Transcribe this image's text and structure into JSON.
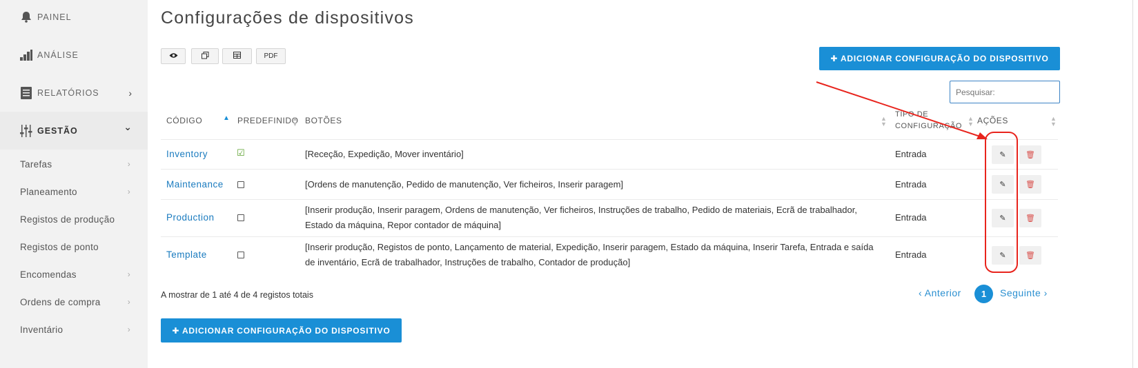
{
  "sidebar": {
    "main_items": [
      {
        "label": "PAINEL",
        "icon": "bell-icon"
      },
      {
        "label": "ANÁLISE",
        "icon": "bar-chart-icon"
      },
      {
        "label": "RELATÓRIOS",
        "icon": "reports-icon",
        "chevron": "›"
      },
      {
        "label": "GESTÃO",
        "icon": "sliders-icon",
        "chevron": "⌄"
      }
    ],
    "sub_items": [
      {
        "label": "Tarefas",
        "chevron": "›"
      },
      {
        "label": "Planeamento",
        "chevron": "›"
      },
      {
        "label": "Registos de produção",
        "chevron": ""
      },
      {
        "label": "Registos de ponto",
        "chevron": ""
      },
      {
        "label": "Encomendas",
        "chevron": "›"
      },
      {
        "label": "Ordens de compra",
        "chevron": "›"
      },
      {
        "label": "Inventário",
        "chevron": "›"
      }
    ]
  },
  "page": {
    "title": "Configurações de dispositivos",
    "toolbar": {
      "view_icon": "eye-icon",
      "copy_icon": "copy-icon",
      "table_icon": "table-icon",
      "pdf_label": "PDF"
    },
    "add_button_label": "✚ ADICIONAR CONFIGURAÇÃO DO DISPOSITIVO",
    "search_placeholder": "Pesquisar:"
  },
  "table": {
    "headers": {
      "code": "CÓDIGO",
      "default": "PREDEFINIDO",
      "buttons": "BOTÕES",
      "config_type_line1": "TIPO DE",
      "config_type_line2": "CONFIGURAÇÃO",
      "actions": "AÇÕES"
    },
    "rows": [
      {
        "code": "Inventory",
        "default": true,
        "buttons_line1": "[Receção, Expedição, Mover inventário]",
        "buttons_line2": "",
        "type": "Entrada"
      },
      {
        "code": "Maintenance",
        "default": false,
        "buttons_line1": "[Ordens de manutenção, Pedido de manutenção, Ver ficheiros, Inserir paragem]",
        "buttons_line2": "",
        "type": "Entrada"
      },
      {
        "code": "Production",
        "default": false,
        "buttons_line1": "[Inserir produção, Inserir paragem, Ordens de manutenção, Ver ficheiros, Instruções de trabalho, Pedido de materiais, Ecrã de trabalhador,",
        "buttons_line2": "Estado da máquina, Repor contador de máquina]",
        "type": "Entrada"
      },
      {
        "code": "Template",
        "default": false,
        "buttons_line1": "[Inserir produção, Registos de ponto, Lançamento de material, Expedição, Inserir paragem, Estado da máquina, Inserir Tarefa, Entrada e saída",
        "buttons_line2": "de inventário, Ecrã de trabalhador, Instruções de trabalho, Contador de produção]",
        "type": "Entrada"
      }
    ],
    "info": "A mostrar de 1 até 4 de 4 registos totais"
  },
  "pagination": {
    "prev": "‹ Anterior",
    "current": "1",
    "next": "Seguinte ›"
  },
  "colors": {
    "accent": "#1a8fd6",
    "annotation": "#e8231c"
  }
}
